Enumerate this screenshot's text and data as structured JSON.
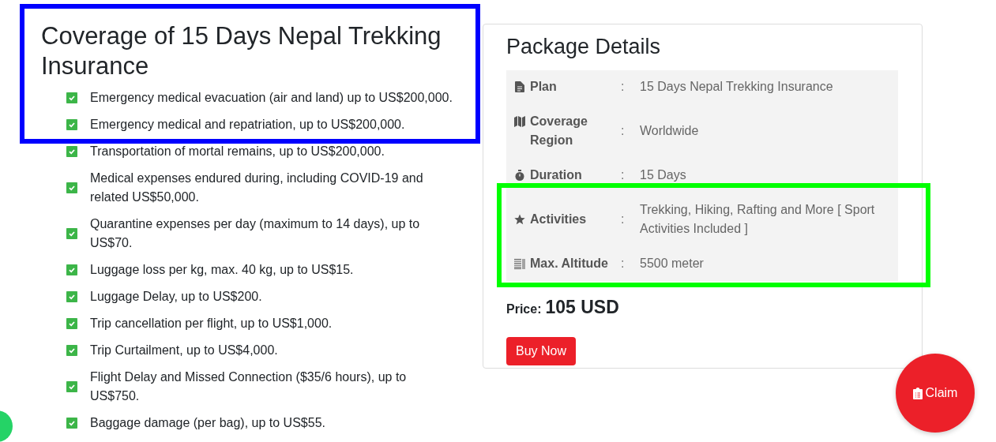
{
  "coverage": {
    "title": "Coverage of 15 Days Nepal Trekking Insurance",
    "items": [
      {
        "text": "Emergency medical evacuation (air and land) up to US$200,000.",
        "checked": true
      },
      {
        "text": "Emergency medical and repatriation, up to US$200,000.",
        "checked": true
      },
      {
        "text": "Transportation of mortal remains, up to US$200,000.",
        "checked": true
      },
      {
        "text": "Medical expenses endured during, including COVID-19 and related US$50,000.",
        "checked": true
      },
      {
        "text": "Quarantine expenses per day (maximum to 14 days), up to US$70.",
        "checked": true
      },
      {
        "text": "Luggage loss per kg, max. 40 kg, up to US$15.",
        "checked": true
      },
      {
        "text": "Luggage Delay, up to US$200.",
        "checked": true
      },
      {
        "text": "Trip cancellation per flight, up to US$1,000.",
        "checked": true
      },
      {
        "text": "Trip Curtailment, up to US$4,000.",
        "checked": true
      },
      {
        "text": "Flight Delay and Missed Connection ($35/6 hours), up to US$750.",
        "checked": true
      },
      {
        "text": "Baggage damage (per bag), up to US$55.",
        "checked": true
      }
    ]
  },
  "package": {
    "title": "Package Details",
    "rows": [
      {
        "kind": "document",
        "label": "Plan",
        "separator": ":",
        "value": "15 Days Nepal Trekking Insurance"
      },
      {
        "kind": "map",
        "label": "Coverage Region",
        "separator": ":",
        "value": "Worldwide"
      },
      {
        "kind": "stopwatch",
        "label": "Duration",
        "separator": ":",
        "value": "15 Days"
      },
      {
        "kind": "star",
        "label": "Activities",
        "separator": ":",
        "value": "Trekking, Hiking, Rafting and More [ Sport Activities Included ]"
      },
      {
        "kind": "list",
        "label": "Max. Altitude",
        "separator": ":",
        "value": "5500 meter"
      }
    ],
    "price_label": "Price:",
    "price": "105 USD",
    "buy_button": "Buy Now"
  },
  "claim_button": "Claim",
  "highlights": [
    {
      "color": "#0000ff"
    },
    {
      "color": "#00ff00"
    }
  ]
}
